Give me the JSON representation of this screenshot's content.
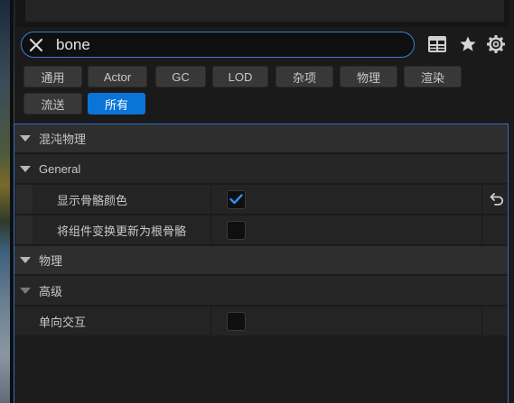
{
  "search": {
    "value": "bone"
  },
  "toolbar": {
    "icons": [
      "table-view-icon",
      "favorites-star-icon",
      "settings-gear-icon"
    ]
  },
  "filters": [
    "通用",
    "Actor",
    "GC",
    "LOD",
    "杂项",
    "物理",
    "渲染",
    "流送",
    "所有"
  ],
  "active_filter": "所有",
  "panel": {
    "cat1": "混沌物理",
    "sub1": "General",
    "prop1_label": "显示骨骼颜色",
    "prop1_checked": true,
    "prop2_label": "将组件变换更新为根骨骼",
    "prop2_checked": false,
    "cat2": "物理",
    "sub2": "高级",
    "prop3_label": "单向交互",
    "prop3_checked": false
  },
  "colors": {
    "accent": "#0a75d6",
    "focus_border": "#3d7bd6",
    "background": "#1a1a1a"
  }
}
